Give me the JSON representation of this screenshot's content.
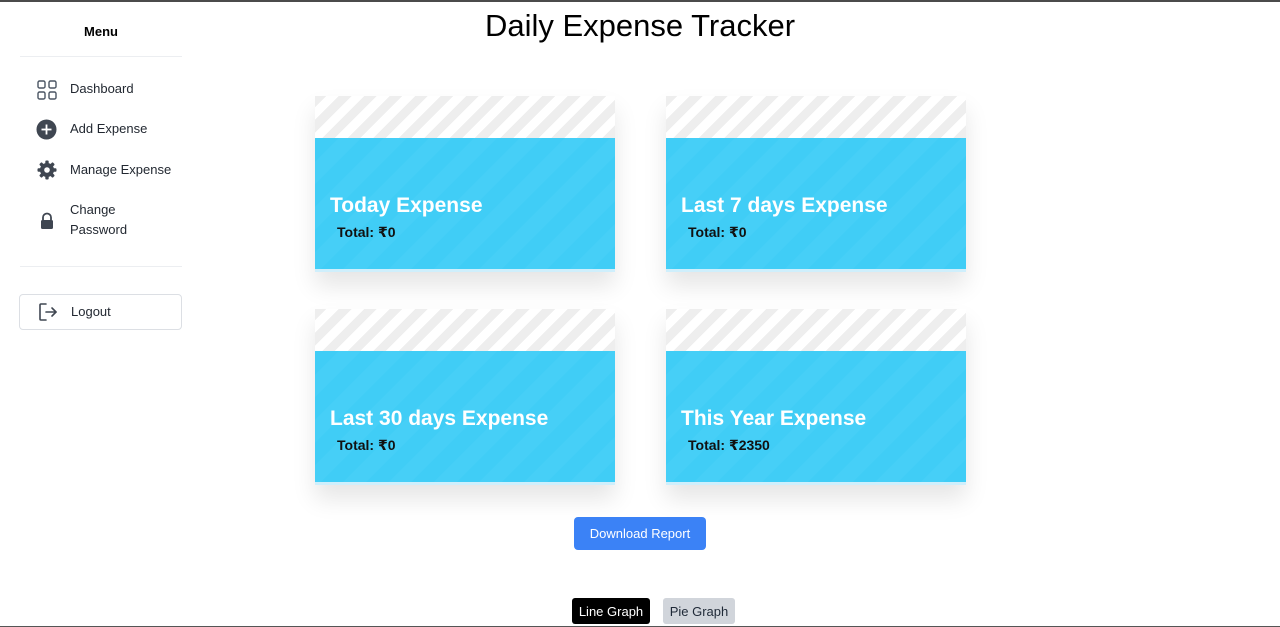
{
  "sidebar": {
    "menu_title": "Menu",
    "items": [
      {
        "label": "Dashboard",
        "icon": "grid-icon"
      },
      {
        "label": "Add Expense",
        "icon": "plus-circle-icon"
      },
      {
        "label": "Manage Expense",
        "icon": "gear-icon"
      },
      {
        "label": "Change Password",
        "icon": "lock-icon"
      }
    ],
    "logout_label": "Logout",
    "logout_icon": "logout-icon"
  },
  "header": {
    "title": "Daily Expense Tracker"
  },
  "cards": [
    {
      "title": "Today Expense",
      "total": "Total: ₹0"
    },
    {
      "title": "Last 7 days Expense",
      "total": "Total: ₹0"
    },
    {
      "title": "Last 30 days Expense",
      "total": "Total: ₹0"
    },
    {
      "title": "This Year Expense",
      "total": "Total: ₹2350"
    }
  ],
  "actions": {
    "download_label": "Download Report",
    "line_graph_label": "Line Graph",
    "pie_graph_label": "Pie Graph"
  },
  "colors": {
    "card_accent": "#40cdf6",
    "primary_button": "#3b82f6",
    "active_toggle": "#000000",
    "inactive_toggle": "#d1d5db"
  }
}
